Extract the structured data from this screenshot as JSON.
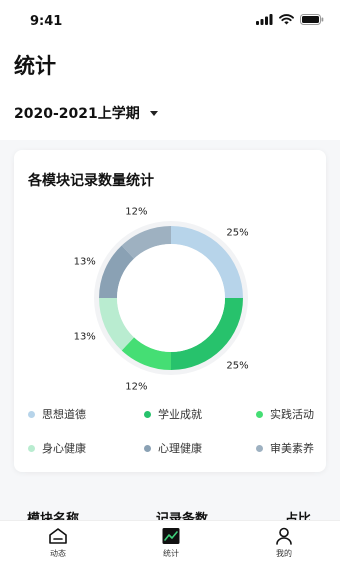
{
  "status_bar": {
    "time": "9:41"
  },
  "header": {
    "title": "统计"
  },
  "term_selector": {
    "label": "2020-2021上学期"
  },
  "chart_card": {
    "title": "各模块记录数量统计"
  },
  "chart_data": {
    "type": "pie",
    "title": "各模块记录数量统计",
    "categories": [
      "思想道德",
      "学业成就",
      "实践活动",
      "身心健康",
      "心理健康",
      "审美素养"
    ],
    "values": [
      25,
      25,
      12,
      13,
      13,
      12
    ],
    "value_labels": [
      "25%",
      "25%",
      "12%",
      "13%",
      "13%",
      "12%"
    ],
    "colors": [
      "#b7d4ea",
      "#27c26c",
      "#45de74",
      "#b9ecd0",
      "#8aa1b4",
      "#9eb1c1"
    ],
    "donut": true,
    "legend_position": "bottom"
  },
  "legend": [
    {
      "label": "思想道德",
      "color": "#b7d4ea"
    },
    {
      "label": "学业成就",
      "color": "#27c26c"
    },
    {
      "label": "实践活动",
      "color": "#45de74"
    },
    {
      "label": "身心健康",
      "color": "#b9ecd0"
    },
    {
      "label": "心理健康",
      "color": "#8aa1b4"
    },
    {
      "label": "审美素养",
      "color": "#9eb1c1"
    }
  ],
  "table": {
    "col_module": "模块名称",
    "col_count": "记录条数",
    "col_ratio": "占比"
  },
  "tabbar": {
    "items": [
      {
        "label": "动态",
        "icon": "home-icon"
      },
      {
        "label": "统计",
        "icon": "chart-icon",
        "active": true
      },
      {
        "label": "我的",
        "icon": "user-icon"
      }
    ]
  }
}
